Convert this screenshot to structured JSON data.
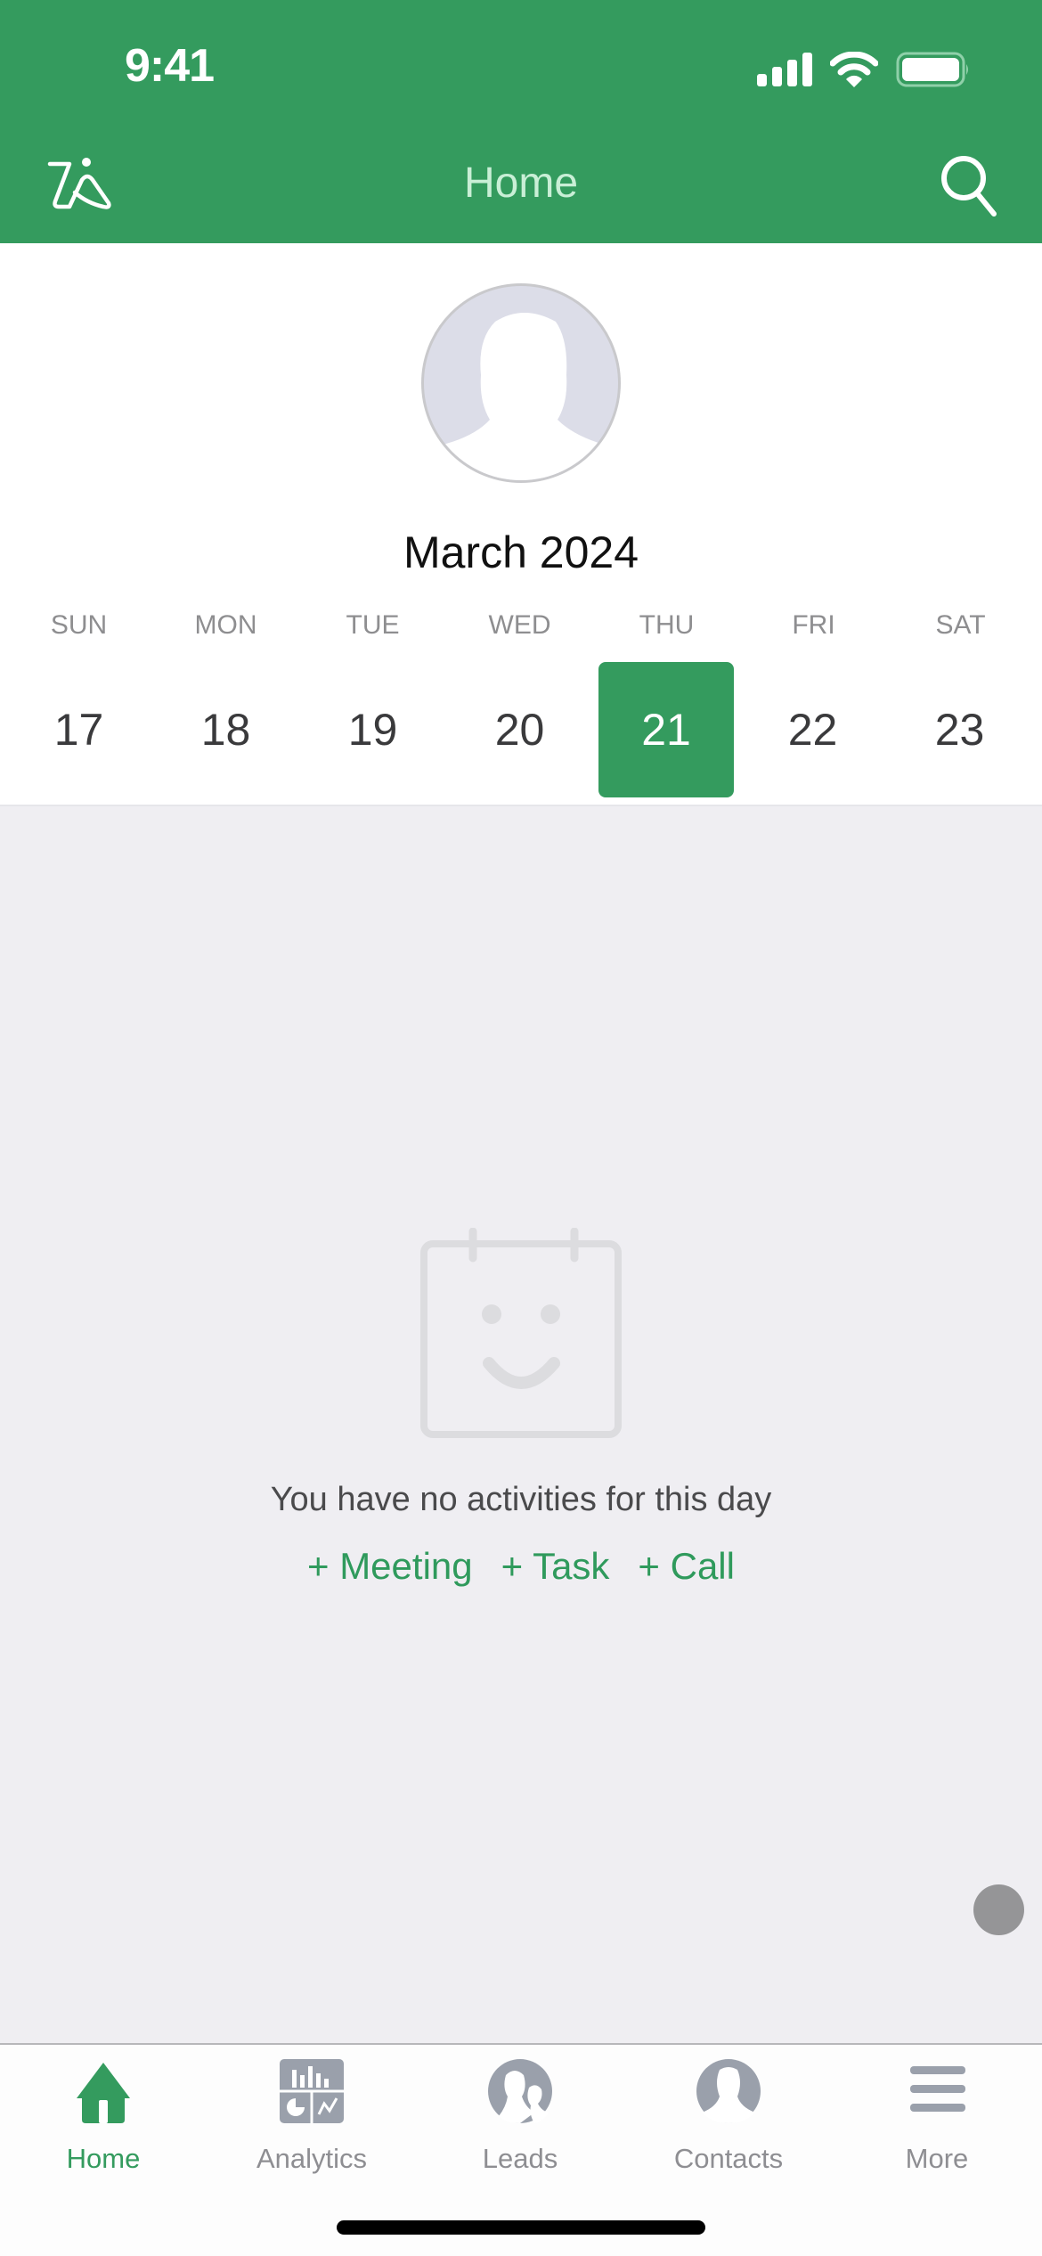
{
  "status_bar": {
    "time": "9:41",
    "icons": [
      "cellular-signal-icon",
      "wifi-icon",
      "battery-icon"
    ]
  },
  "nav": {
    "title": "Home",
    "left_icon": "zia-icon",
    "right_icon": "search-icon"
  },
  "colors": {
    "brand": "#349b5e",
    "background": "#efeef2",
    "inactive": "#9aa0ab"
  },
  "calendar": {
    "month_label": "March 2024",
    "weekdays": [
      "SUN",
      "MON",
      "TUE",
      "WED",
      "THU",
      "FRI",
      "SAT"
    ],
    "dates": [
      "17",
      "18",
      "19",
      "20",
      "21",
      "22",
      "23"
    ],
    "selected_index": 4
  },
  "empty_state": {
    "icon": "calendar-smile-icon",
    "message": "You have no activities for this day",
    "actions": [
      "+ Meeting",
      "+ Task",
      "+ Call"
    ]
  },
  "tabbar": {
    "items": [
      {
        "label": "Home",
        "icon": "home-icon",
        "active": true
      },
      {
        "label": "Analytics",
        "icon": "analytics-icon",
        "active": false
      },
      {
        "label": "Leads",
        "icon": "leads-icon",
        "active": false
      },
      {
        "label": "Contacts",
        "icon": "contacts-icon",
        "active": false
      },
      {
        "label": "More",
        "icon": "menu-icon",
        "active": false
      }
    ]
  }
}
